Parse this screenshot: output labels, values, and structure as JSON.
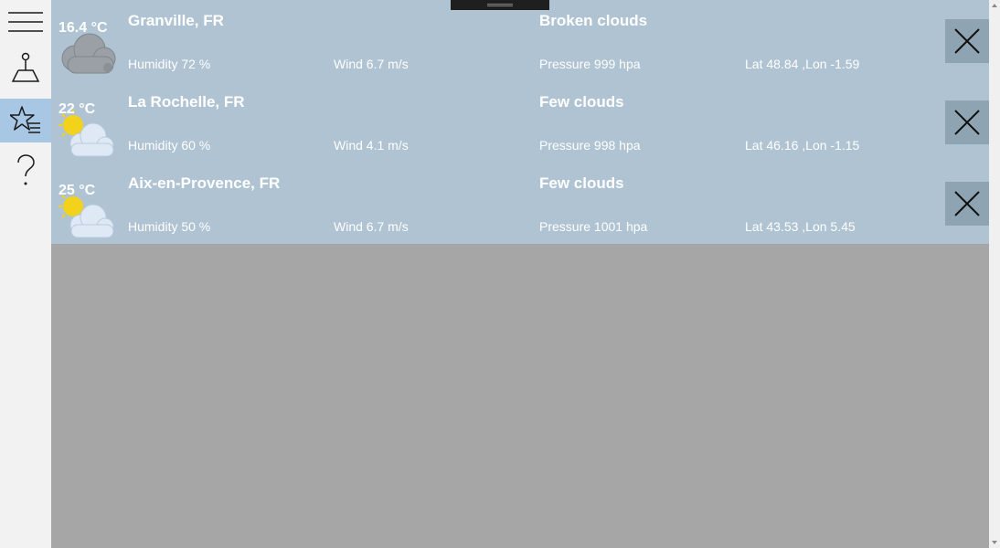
{
  "sidebar": {
    "items": [
      {
        "icon": "hamburger-menu-icon",
        "active": false
      },
      {
        "icon": "map-pin-icon",
        "active": false
      },
      {
        "icon": "favorites-list-icon",
        "active": true
      },
      {
        "icon": "help-question-icon",
        "active": false
      }
    ],
    "active_color": "#a7c7e4"
  },
  "cities": [
    {
      "temp": "16.4 °C",
      "name": "Granville, FR",
      "description": "Broken clouds",
      "humidity": "Humidity 72 %",
      "wind": "Wind 6.7 m/s",
      "pressure": "Pressure 999 hpa",
      "coords": "Lat 48.84 ,Lon -1.59",
      "icon": "broken-clouds-icon"
    },
    {
      "temp": "22 °C",
      "name": "La Rochelle, FR",
      "description": "Few clouds",
      "humidity": "Humidity 60 %",
      "wind": "Wind 4.1 m/s",
      "pressure": "Pressure 998 hpa",
      "coords": "Lat 46.16 ,Lon -1.15",
      "icon": "few-clouds-icon"
    },
    {
      "temp": "25 °C",
      "name": "Aix-en-Provence, FR",
      "description": "Few clouds",
      "humidity": "Humidity 50 %",
      "wind": "Wind 6.7 m/s",
      "pressure": "Pressure 1001 hpa",
      "coords": "Lat 43.53 ,Lon 5.45",
      "icon": "few-clouds-icon"
    }
  ],
  "colors": {
    "row_background": "#afc3d2",
    "main_background": "#a6a6a6",
    "delete_button": "#8fa4b2"
  }
}
